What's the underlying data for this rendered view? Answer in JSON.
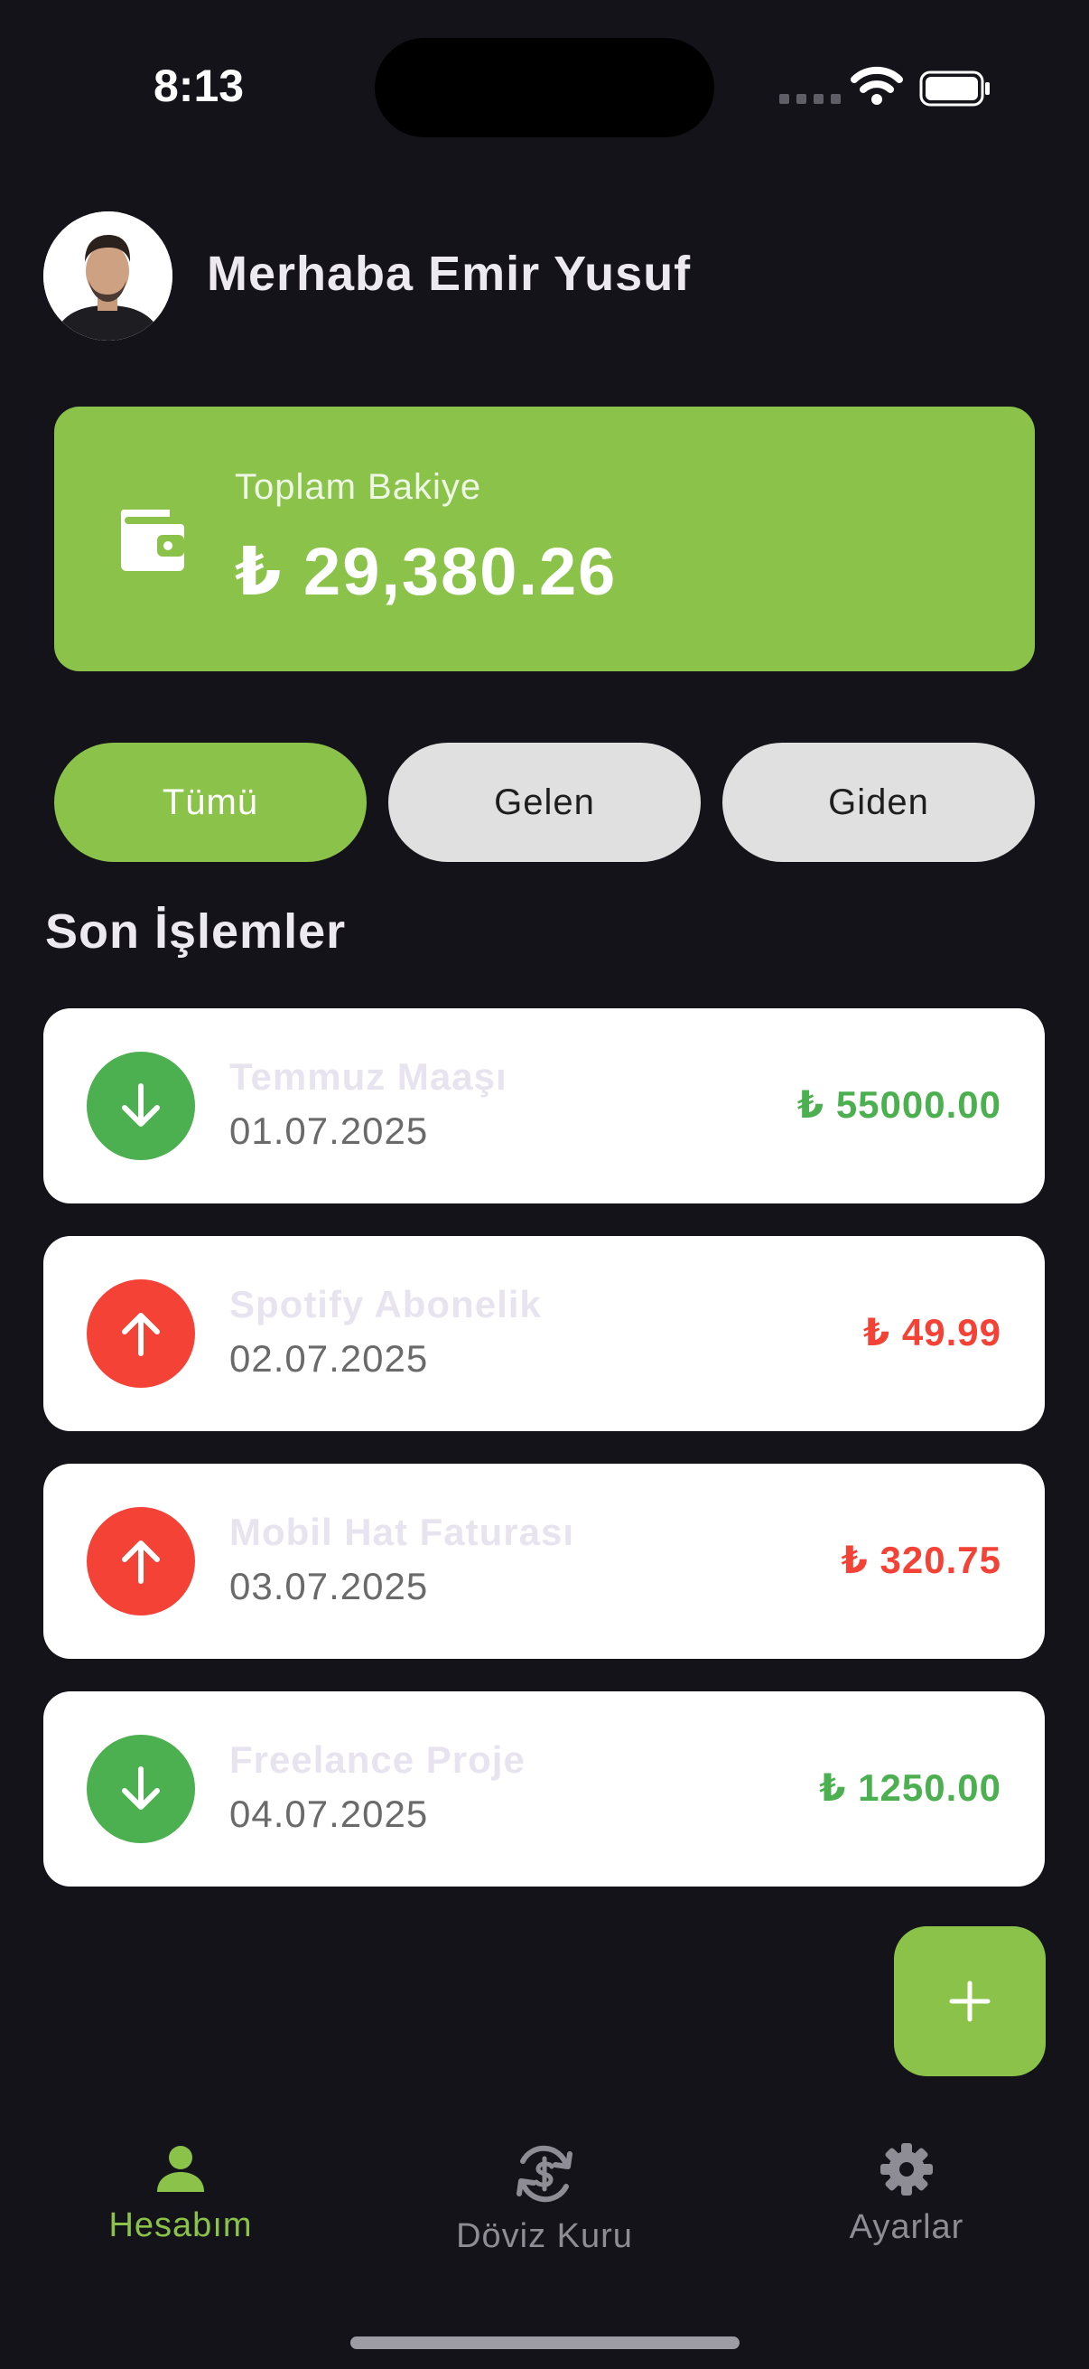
{
  "status_bar": {
    "time": "8:13"
  },
  "header": {
    "greeting": "Merhaba Emir Yusuf"
  },
  "balance": {
    "label": "Toplam Bakiye",
    "value": "₺ 29,380.26"
  },
  "filters": {
    "all": "Tümü",
    "incoming": "Gelen",
    "outgoing": "Giden"
  },
  "section_title": "Son İşlemler",
  "transactions": [
    {
      "title": "Temmuz Maaşı",
      "date": "01.07.2025",
      "amount": "₺ 55000.00",
      "type": "income"
    },
    {
      "title": "Spotify Abonelik",
      "date": "02.07.2025",
      "amount": "₺ 49.99",
      "type": "expense"
    },
    {
      "title": "Mobil Hat Faturası",
      "date": "03.07.2025",
      "amount": "₺ 320.75",
      "type": "expense"
    },
    {
      "title": "Freelance Proje",
      "date": "04.07.2025",
      "amount": "₺ 1250.00",
      "type": "income"
    }
  ],
  "nav": {
    "account": "Hesabım",
    "exchange": "Döviz Kuru",
    "settings": "Ayarlar"
  },
  "colors": {
    "accent": "#8bc34a",
    "income": "#4caf50",
    "expense": "#f44336",
    "background": "#15131a"
  }
}
